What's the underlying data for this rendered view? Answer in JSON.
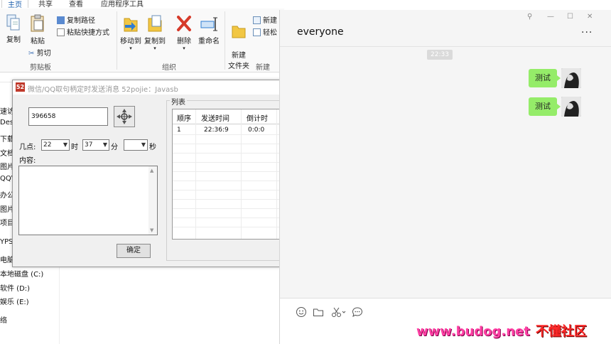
{
  "explorer": {
    "tabs": [
      "主页",
      "共享",
      "查看",
      "应用程序工具"
    ],
    "ribbon": {
      "copy": "复制",
      "paste": "粘贴",
      "copy_path": "复制路径",
      "paste_shortcut": "粘贴快捷方式",
      "cut": "剪切",
      "move_to": "移动到",
      "copy_to": "复制到",
      "delete": "删除",
      "rename": "重命名",
      "new_folder": "新建\n文件夹",
      "new_item": "新建",
      "easy_access": "轻松",
      "groups": {
        "clipboard": "剪贴板",
        "organize": "组织",
        "new": "新建"
      }
    },
    "nav_items": [
      "速访",
      "Desk",
      "下载",
      "文档",
      "图片",
      "QQV",
      "办公",
      "图片",
      "项目",
      "YPS网",
      "电脑",
      "本地磁盘 (C:)",
      "软件 (D:)",
      "娱乐 (E:)",
      "络"
    ]
  },
  "scheduler": {
    "title": "微信/QQ取句柄定时发送消息 52pojie：Javasb",
    "handle_value": "396658",
    "hour_label": "几点:",
    "hour_value": "22",
    "hour_unit": "时",
    "minute_value": "37",
    "minute_unit": "分",
    "second_value": "",
    "second_unit": "秒",
    "content_label": "内容:",
    "ok_label": "确定",
    "list_label": "列表",
    "table": {
      "headers": [
        "顺序",
        "发送时间",
        "倒计时"
      ],
      "rows": [
        [
          "1",
          "22:36:9",
          "0:0:0"
        ]
      ]
    }
  },
  "chat": {
    "title": "everyone",
    "window_controls": [
      "⚲",
      "—",
      "☐",
      "✕"
    ],
    "more": "···",
    "timestamp": "22:33",
    "messages": [
      {
        "text": "测试"
      },
      {
        "text": "测试"
      }
    ]
  },
  "watermark": {
    "url": "www.budog.net",
    "name": "不懂社区"
  },
  "colors": {
    "bubble": "#95ec69",
    "chat_bg": "#f5f5f5",
    "dialog_bg": "#f0f0f0"
  }
}
